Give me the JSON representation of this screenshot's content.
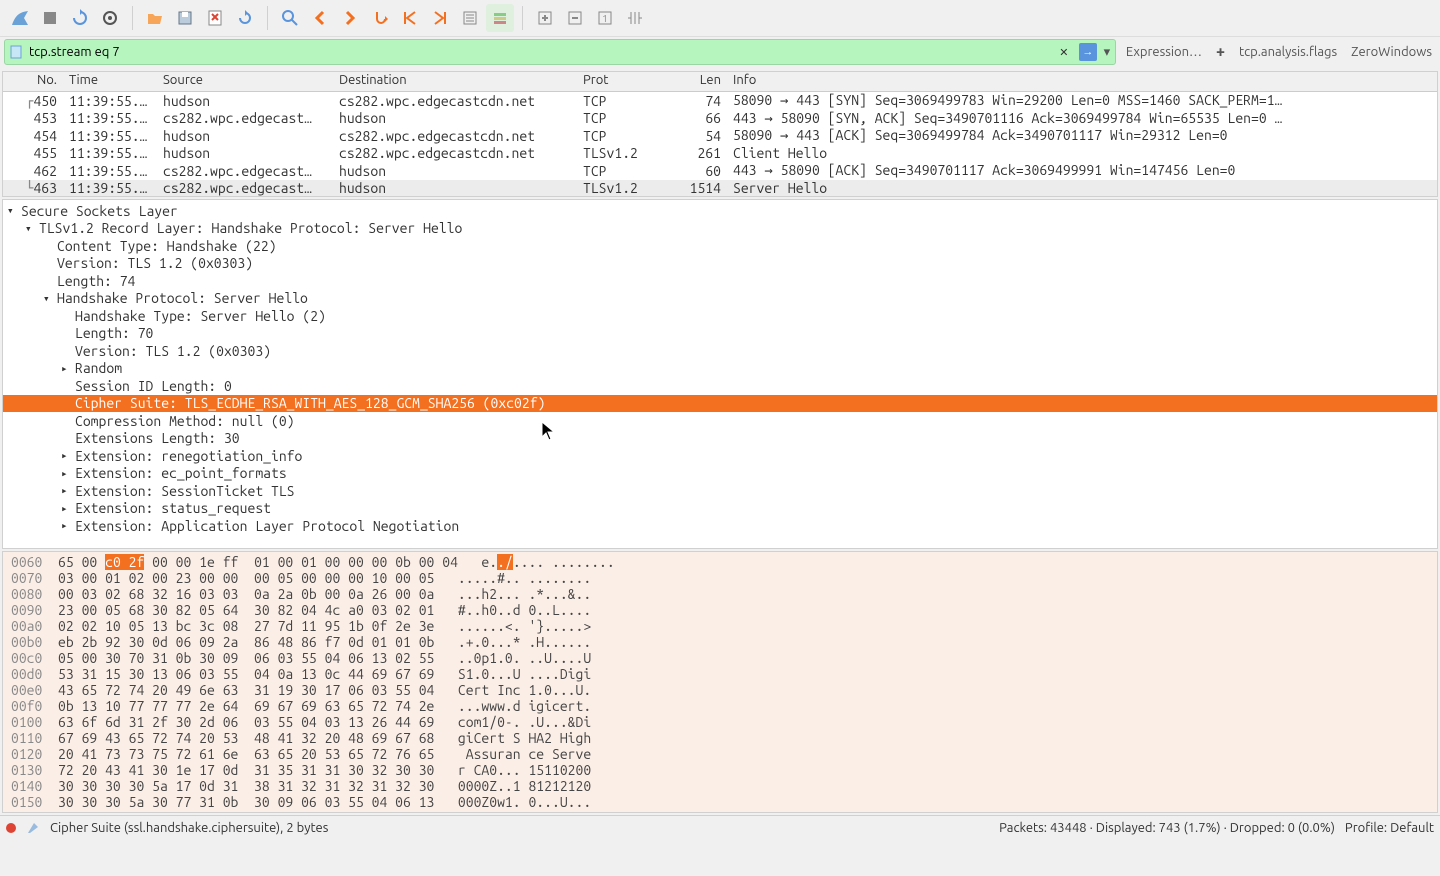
{
  "filter": {
    "value": "tcp.stream eq 7",
    "expression_label": "Expression…",
    "pin1": "tcp.analysis.flags",
    "pin2": "ZeroWindows",
    "add": "+"
  },
  "columns": {
    "no": "No.",
    "time": "Time",
    "source": "Source",
    "destination": "Destination",
    "prot": "Prot",
    "len": "Len",
    "info": "Info"
  },
  "packets": [
    {
      "no": "450",
      "time": "11:39:55.…",
      "src": "hudson",
      "dst": "cs282.wpc.edgecastcdn.net",
      "prot": "TCP",
      "len": "74",
      "info": "58090 → 443 [SYN] Seq=3069499783 Win=29200 Len=0 MSS=1460 SACK_PERM=1…"
    },
    {
      "no": "453",
      "time": "11:39:55.…",
      "src": "cs282.wpc.edgecast…",
      "dst": "hudson",
      "prot": "TCP",
      "len": "66",
      "info": "443 → 58090 [SYN, ACK] Seq=3490701116 Ack=3069499784 Win=65535 Len=0 …"
    },
    {
      "no": "454",
      "time": "11:39:55.…",
      "src": "hudson",
      "dst": "cs282.wpc.edgecastcdn.net",
      "prot": "TCP",
      "len": "54",
      "info": "58090 → 443 [ACK] Seq=3069499784 Ack=3490701117 Win=29312 Len=0"
    },
    {
      "no": "455",
      "time": "11:39:55.…",
      "src": "hudson",
      "dst": "cs282.wpc.edgecastcdn.net",
      "prot": "TLSv1.2",
      "len": "261",
      "info": "Client Hello"
    },
    {
      "no": "462",
      "time": "11:39:55.…",
      "src": "cs282.wpc.edgecast…",
      "dst": "hudson",
      "prot": "TCP",
      "len": "60",
      "info": "443 → 58090 [ACK] Seq=3490701117 Ack=3069499991 Win=147456 Len=0"
    },
    {
      "no": "463",
      "time": "11:39:55.…",
      "src": "cs282.wpc.edgecast…",
      "dst": "hudson",
      "prot": "TLSv1.2",
      "len": "1514",
      "info": "Server Hello"
    }
  ],
  "tree": {
    "l0": "Secure Sockets Layer",
    "l1": "TLSv1.2 Record Layer: Handshake Protocol: Server Hello",
    "l2a": "Content Type: Handshake (22)",
    "l2b": "Version: TLS 1.2 (0x0303)",
    "l2c": "Length: 74",
    "l3": "Handshake Protocol: Server Hello",
    "l4a": "Handshake Type: Server Hello (2)",
    "l4b": "Length: 70",
    "l4c": "Version: TLS 1.2 (0x0303)",
    "l4d": "Random",
    "l4e": "Session ID Length: 0",
    "l4f": "Cipher Suite: TLS_ECDHE_RSA_WITH_AES_128_GCM_SHA256 (0xc02f)",
    "l4g": "Compression Method: null (0)",
    "l4h": "Extensions Length: 30",
    "l4i": "Extension: renegotiation_info",
    "l4j": "Extension: ec_point_formats",
    "l4k": "Extension: SessionTicket TLS",
    "l4l": "Extension: status_request",
    "l4m": "Extension: Application Layer Protocol Negotiation"
  },
  "hex": {
    "offs": [
      "0060",
      "0070",
      "0080",
      "0090",
      "00a0",
      "00b0",
      "00c0",
      "00d0",
      "00e0",
      "00f0",
      "0100",
      "0110",
      "0120",
      "0130",
      "0140",
      "0150"
    ],
    "hi_a": "c0 2f",
    "hi_b": "./",
    "row0_a": "65 00 ",
    "row0_c": " 00 00 1e ff  01 00 01 00 00 00 0b 00 04",
    "row0_d": "   e.",
    "row0_e": ".... ........",
    "rows": [
      "03 00 01 02 00 23 00 00  00 05 00 00 00 10 00 05   .....#.. ........",
      "00 03 02 68 32 16 03 03  0a 2a 0b 00 0a 26 00 0a   ...h2... .*...&..",
      "23 00 05 68 30 82 05 64  30 82 04 4c a0 03 02 01   #..h0..d 0..L....",
      "02 02 10 05 13 bc 3c 08  27 7d 11 95 1b 0f 2e 3e   ......<. '}.....>",
      "eb 2b 92 30 0d 06 09 2a  86 48 86 f7 0d 01 01 0b   .+.0...* .H......",
      "05 00 30 70 31 0b 30 09  06 03 55 04 06 13 02 55   ..0p1.0. ..U....U",
      "53 31 15 30 13 06 03 55  04 0a 13 0c 44 69 67 69   S1.0...U ....Digi",
      "43 65 72 74 20 49 6e 63  31 19 30 17 06 03 55 04   Cert Inc 1.0...U.",
      "0b 13 10 77 77 77 2e 64  69 67 69 63 65 72 74 2e   ...www.d igicert.",
      "63 6f 6d 31 2f 30 2d 06  03 55 04 03 13 26 44 69   com1/0-. .U...&Di",
      "67 69 43 65 72 74 20 53  48 41 32 20 48 69 67 68   giCert S HA2 High",
      "20 41 73 73 75 72 61 6e  63 65 20 53 65 72 76 65    Assuran ce Serve",
      "72 20 43 41 30 1e 17 0d  31 35 31 31 30 32 30 30   r CA0... 15110200",
      "30 30 30 30 5a 17 0d 31  38 31 32 31 32 31 32 30   0000Z..1 81212120",
      "30 30 30 5a 30 77 31 0b  30 09 06 03 55 04 06 13   000Z0w1. 0...U..."
    ]
  },
  "status": {
    "field": "Cipher Suite (ssl.handshake.ciphersuite), 2 bytes",
    "stats": "Packets: 43448 · Displayed: 743 (1.7%) · Dropped: 0 (0.0%)",
    "profile": "Profile: Default"
  }
}
